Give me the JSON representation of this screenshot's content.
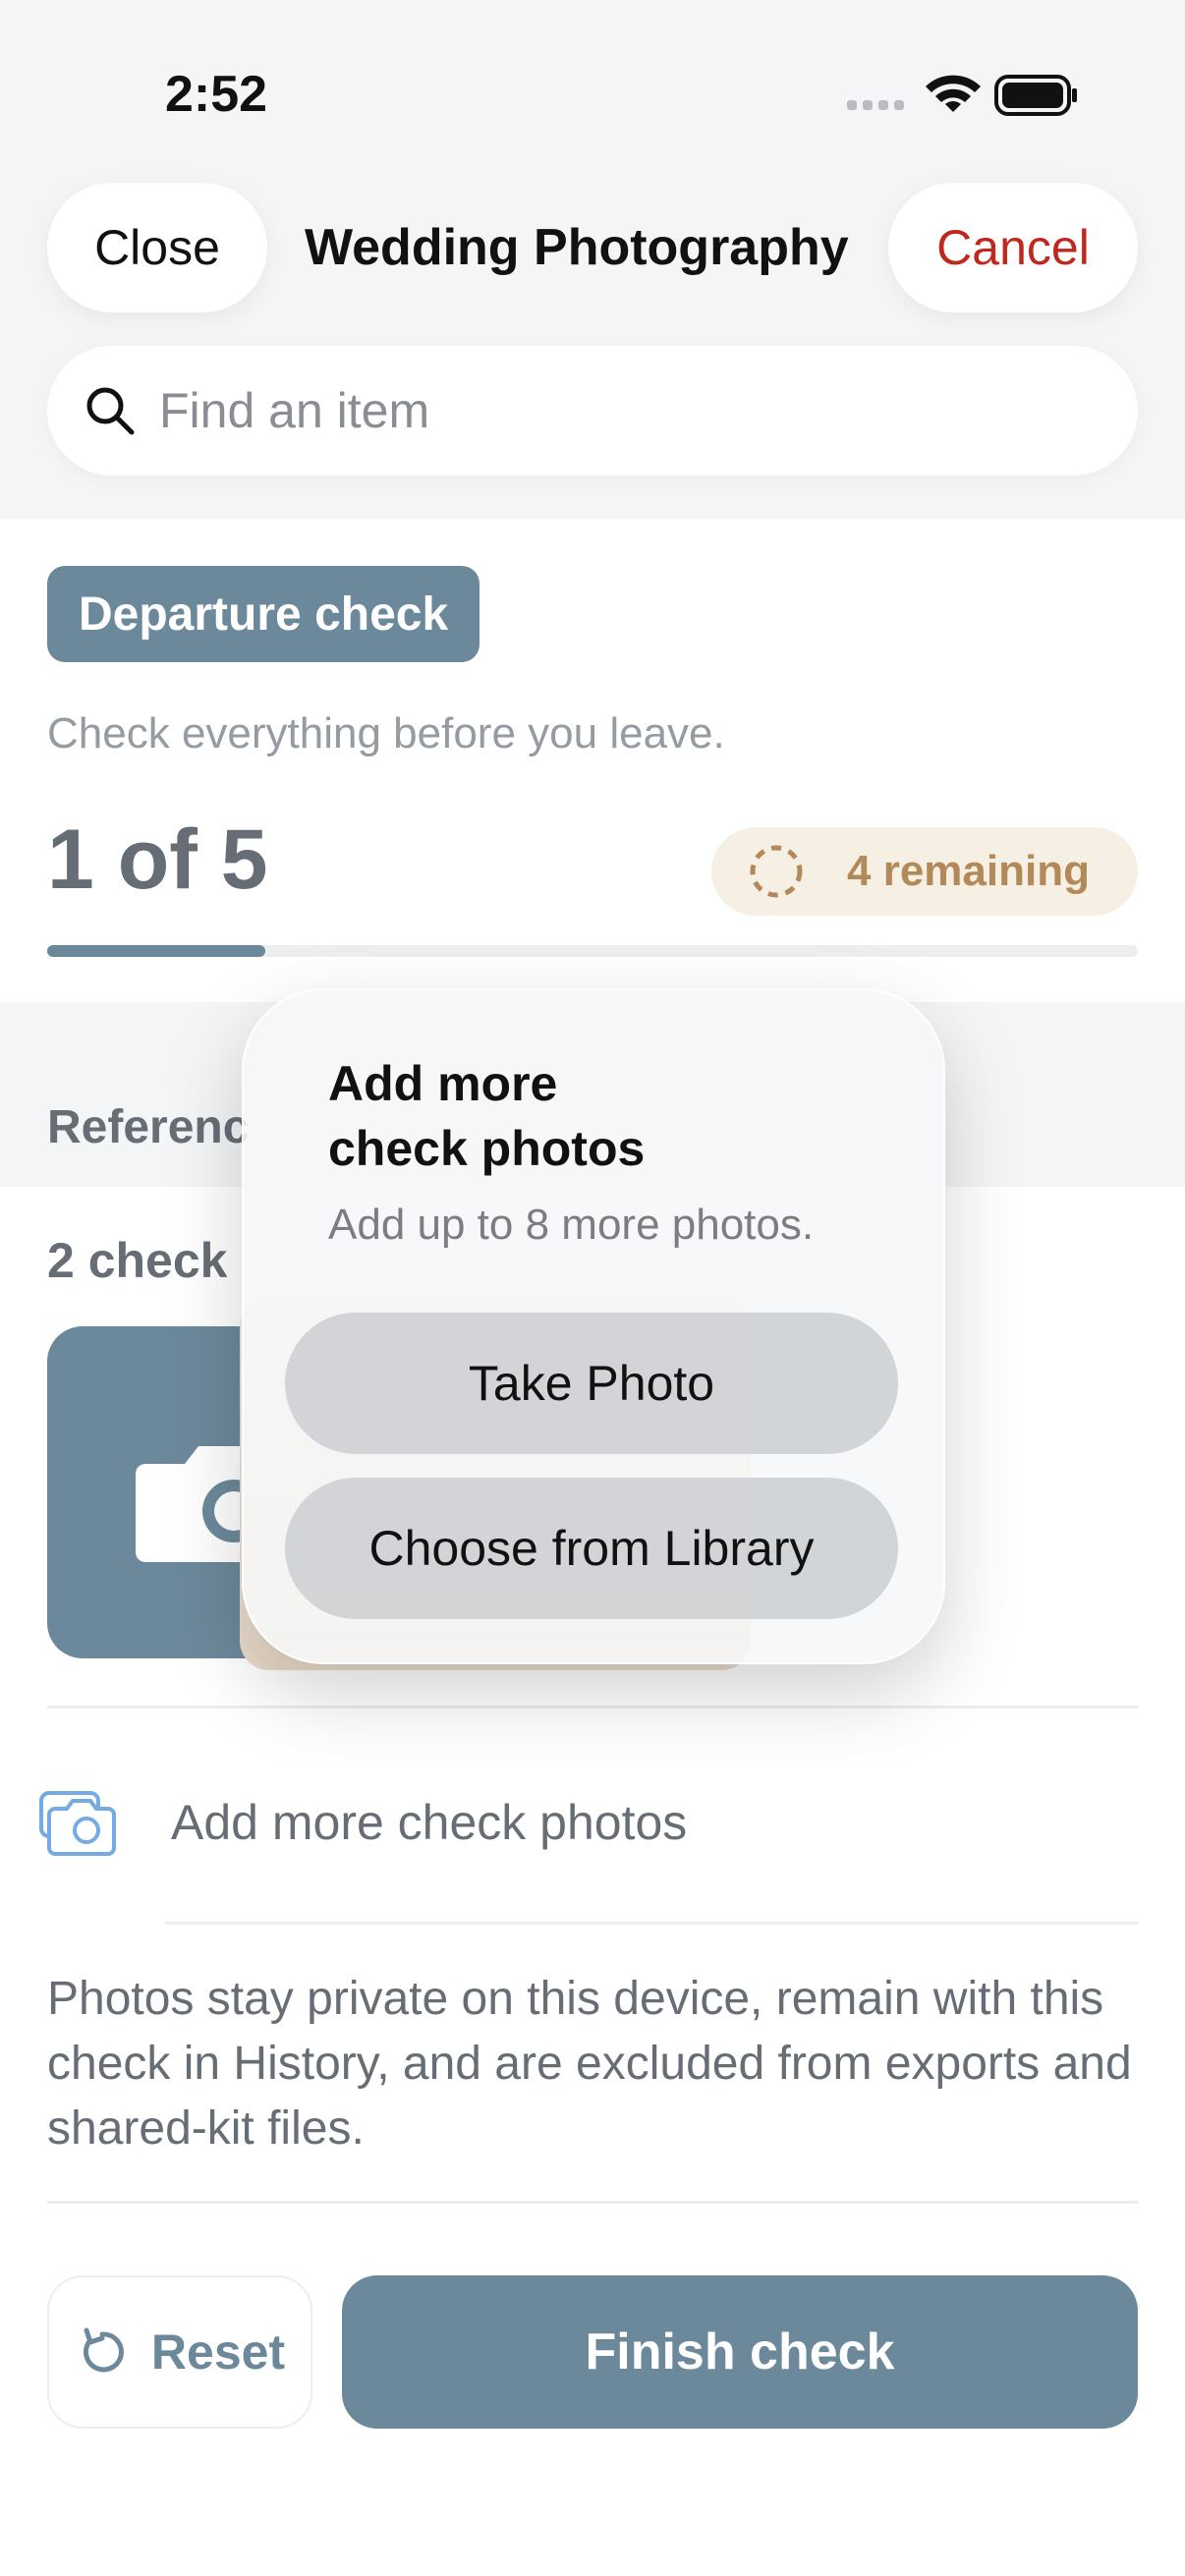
{
  "status_bar": {
    "time": "2:52"
  },
  "nav": {
    "close_label": "Close",
    "title": "Wedding Photography",
    "cancel_label": "Cancel"
  },
  "search": {
    "placeholder": "Find an item"
  },
  "check": {
    "tag": "Departure check",
    "subtitle": "Check everything before you leave.",
    "progress_text": "1 of 5",
    "progress_fraction": 0.2,
    "remaining": "4 remaining"
  },
  "reference": {
    "section_label": "Referenc",
    "photos_label": "2 check"
  },
  "add_more": {
    "label": "Add more check photos"
  },
  "privacy_note": "Photos stay private on this device, remain with this check in History, and are excluded from exports and shared-kit files.",
  "actions": {
    "reset_label": "Reset",
    "finish_label": "Finish check"
  },
  "popover": {
    "title_line1": "Add more",
    "title_line2": "check photos",
    "subtitle": "Add up to 8 more photos.",
    "take_photo": "Take Photo",
    "choose_library": "Choose from Library"
  },
  "colors": {
    "accent": "#1e4a66",
    "cancel": "#c0271d",
    "remaining_bg": "#f2e6d6",
    "remaining_fg": "#8a4a00"
  }
}
